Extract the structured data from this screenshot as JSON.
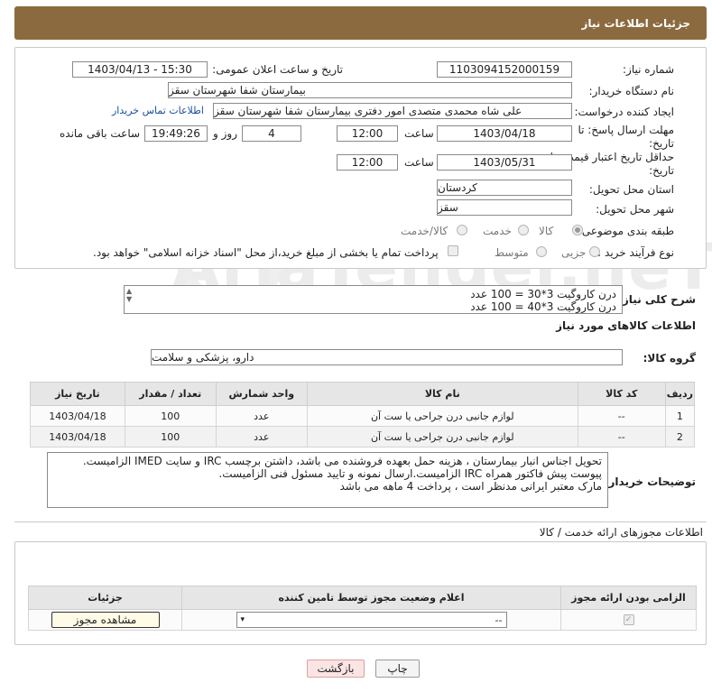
{
  "header": {
    "title": "جزئیات اطلاعات نیاز"
  },
  "form": {
    "need_number": {
      "label": "شماره نیاز:",
      "value": "1103094152000159"
    },
    "announce": {
      "label": "تاریخ و ساعت اعلان عمومی:",
      "value": "1403/04/13 - 15:30"
    },
    "buyer_org": {
      "label": "نام دستگاه خریدار:",
      "value": "بیمارستان شفا شهرستان سقز"
    },
    "creator": {
      "label": "ایجاد کننده درخواست:",
      "value": "علی شاه محمدی متصدی امور دفتری بیمارستان شفا شهرستان سقز",
      "contact_link": "اطلاعات تماس خریدار"
    },
    "reply_deadline": {
      "label_line1": "مهلت ارسال پاسخ: تا",
      "label_line2": "تاریخ:",
      "date": "1403/04/18",
      "time_label": "ساعت",
      "time": "12:00",
      "days": "4",
      "days_label": "روز و",
      "remaining": "19:49:26",
      "remaining_label": "ساعت باقی مانده"
    },
    "price_validity": {
      "label_line1": "حداقل تاریخ اعتبار قیمت: تا",
      "label_line2": "تاریخ:",
      "date": "1403/05/31",
      "time_label": "ساعت",
      "time": "12:00"
    },
    "province": {
      "label": "استان محل تحویل:",
      "value": "کردستان"
    },
    "city": {
      "label": "شهر محل تحویل:",
      "value": "سقز"
    },
    "category": {
      "label": "طبقه بندی موضوعی:",
      "options": [
        "کالا",
        "خدمت",
        "کالا/خدمت"
      ],
      "selected": "کالا"
    },
    "purchase_type": {
      "label": "نوع فرآیند خرید :",
      "options": [
        "جزیی",
        "متوسط"
      ],
      "note": "پرداخت تمام یا بخشی از مبلغ خرید،از محل \"اسناد خزانه اسلامی\" خواهد بود."
    }
  },
  "description": {
    "label": "شرح کلی نیاز:",
    "lines": [
      "درن کاروگیت 3*30 = 100 عدد",
      "درن کاروگیت 3*40 = 100 عدد"
    ]
  },
  "goods_info": {
    "title": "اطلاعات کالاهای مورد نیاز",
    "group_label": "گروه کالا:",
    "group_value": "دارو، پزشکی و سلامت",
    "columns": [
      "ردیف",
      "کد کالا",
      "نام کالا",
      "واحد شمارش",
      "تعداد / مقدار",
      "تاریخ نیاز"
    ],
    "rows": [
      [
        "1",
        "--",
        "لوازم جانبی درن جراحی یا ست آن",
        "عدد",
        "100",
        "1403/04/18"
      ],
      [
        "2",
        "--",
        "لوازم جانبی درن جراحی یا ست آن",
        "عدد",
        "100",
        "1403/04/18"
      ]
    ]
  },
  "buyer_notes": {
    "label": "توضیحات خریدار:",
    "lines": [
      "تحویل اجناس  انبار بیمارستان ، هزینه حمل بعهده فروشنده می باشد،  داشتن برچسب IRC  و سایت  IMED  الزامیست.",
      "پیوست پیش فاکتور همراه IRC  الزامیست.ارسال نمونه و تایید مسئول فنی الزامیست.",
      "مارک معتبر ایرانی مدنظر است ، پرداخت 4 ماهه می باشد"
    ]
  },
  "permits": {
    "title": "اطلاعات مجوزهای ارائه خدمت / کالا",
    "columns": [
      "الزامی بودن ارائه مجوز",
      "اعلام وضعیت مجوز توسط تامین کننده",
      "جزئیات"
    ],
    "select_value": "--",
    "view_button": "مشاهده مجوز"
  },
  "actions": {
    "print": "چاپ",
    "back": "بازگشت"
  },
  "watermark": "AriaTender.neT"
}
